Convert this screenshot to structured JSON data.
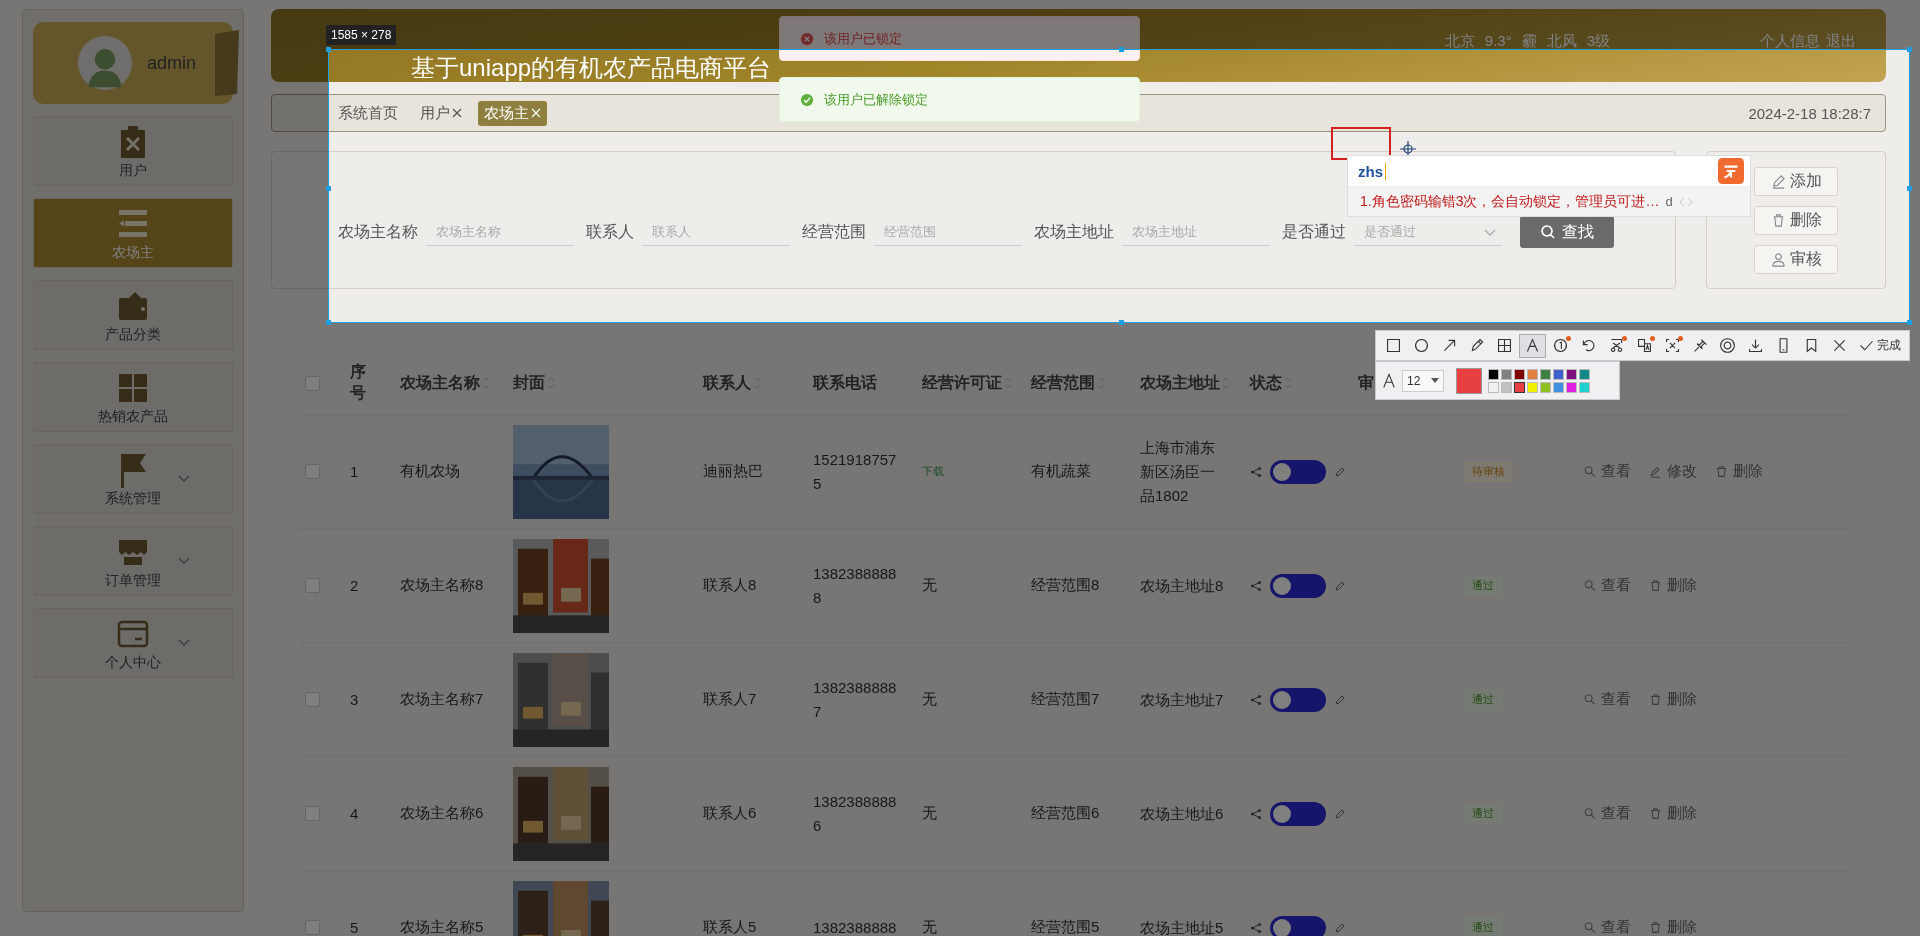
{
  "sidebar": {
    "user": "admin",
    "menu": [
      {
        "label": "用户",
        "selected": false,
        "expandable": false
      },
      {
        "label": "农场主",
        "selected": true,
        "expandable": false
      },
      {
        "label": "产品分类",
        "selected": false,
        "expandable": false
      },
      {
        "label": "热销农产品",
        "selected": false,
        "expandable": false
      },
      {
        "label": "系统管理",
        "selected": false,
        "expandable": true
      },
      {
        "label": "订单管理",
        "selected": false,
        "expandable": true
      },
      {
        "label": "个人中心",
        "selected": false,
        "expandable": true
      }
    ]
  },
  "header": {
    "title": "基于uniapp的有机农产品电商平台",
    "weather": [
      "北京",
      "9.3°",
      "霾",
      "北风",
      "3级"
    ],
    "links": [
      "个人信息",
      "退出"
    ]
  },
  "breadcrumb": {
    "tabs": [
      {
        "label": "系统首页",
        "closable": false,
        "selected": false
      },
      {
        "label": "用户",
        "closable": true,
        "selected": false
      },
      {
        "label": "农场主",
        "closable": true,
        "selected": true
      }
    ],
    "datetime": "2024-2-18 18:28:7"
  },
  "search": {
    "fields": [
      {
        "label": "农场主名称",
        "placeholder": "农场主名称",
        "kind": "input"
      },
      {
        "label": "联系人",
        "placeholder": "联系人",
        "kind": "input"
      },
      {
        "label": "经营范围",
        "placeholder": "经营范围",
        "kind": "input"
      },
      {
        "label": "农场主地址",
        "placeholder": "农场主地址",
        "kind": "input"
      },
      {
        "label": "是否通过",
        "placeholder": "是否通过",
        "kind": "select"
      }
    ],
    "button": "查找"
  },
  "side_buttons": [
    "添加",
    "删除",
    "审核"
  ],
  "table": {
    "all_checked": false,
    "columns": [
      {
        "label": "序号",
        "sortable": false
      },
      {
        "label": "农场主名称",
        "sortable": true
      },
      {
        "label": "封面",
        "sortable": true
      },
      {
        "label": "联系人",
        "sortable": true
      },
      {
        "label": "联系电话",
        "sortable": false
      },
      {
        "label": "经营许可证",
        "sortable": true
      },
      {
        "label": "经营范围",
        "sortable": true
      },
      {
        "label": "农场主地址",
        "sortable": true
      },
      {
        "label": "状态",
        "sortable": true
      },
      {
        "label": "审",
        "sortable": false
      }
    ],
    "rows": [
      {
        "checked": false,
        "index": "1",
        "name": "有机农场",
        "cover": {
          "kind": "picture"
        },
        "contact": "迪丽热巴",
        "phone": "15219187575",
        "license": {
          "kind": "link",
          "text": "下载"
        },
        "scope": "有机蔬菜",
        "address": "上海市浦东新区汤臣一品1802",
        "on": false,
        "review": {
          "kind": "pending",
          "text": "待审核"
        },
        "actions": [
          {
            "kind": "view",
            "label": "查看"
          },
          {
            "kind": "edit",
            "label": "修改"
          },
          {
            "kind": "delete",
            "label": "删除"
          }
        ]
      },
      {
        "checked": false,
        "index": "2",
        "name": "农场主名称8",
        "cover": {
          "kind": "picture"
        },
        "contact": "联系人8",
        "phone": "13823888888",
        "license": {
          "kind": "text",
          "text": "无"
        },
        "scope": "经营范围8",
        "address": "农场主地址8",
        "on": false,
        "review": {
          "kind": "passed",
          "text": "通过"
        },
        "actions": [
          {
            "kind": "view",
            "label": "查看"
          },
          {
            "kind": "delete",
            "label": "删除"
          }
        ]
      },
      {
        "checked": false,
        "index": "3",
        "name": "农场主名称7",
        "cover": {
          "kind": "picture"
        },
        "contact": "联系人7",
        "phone": "13823888887",
        "license": {
          "kind": "text",
          "text": "无"
        },
        "scope": "经营范围7",
        "address": "农场主地址7",
        "on": false,
        "review": {
          "kind": "passed",
          "text": "通过"
        },
        "actions": [
          {
            "kind": "view",
            "label": "查看"
          },
          {
            "kind": "delete",
            "label": "删除"
          }
        ]
      },
      {
        "checked": false,
        "index": "4",
        "name": "农场主名称6",
        "cover": {
          "kind": "picture"
        },
        "contact": "联系人6",
        "phone": "13823888886",
        "license": {
          "kind": "text",
          "text": "无"
        },
        "scope": "经营范围6",
        "address": "农场主地址6",
        "on": false,
        "review": {
          "kind": "passed",
          "text": "通过"
        },
        "actions": [
          {
            "kind": "view",
            "label": "查看"
          },
          {
            "kind": "delete",
            "label": "删除"
          }
        ]
      },
      {
        "checked": false,
        "index": "5",
        "name": "农场主名称5",
        "cover": {
          "kind": "picture"
        },
        "contact": "联系人5",
        "phone": "1382388888",
        "license": {
          "kind": "text",
          "text": "无"
        },
        "scope": "经营范围5",
        "address": "农场主地址5",
        "on": false,
        "review": {
          "kind": "passed",
          "text": "通过"
        },
        "actions": [
          {
            "kind": "view",
            "label": "查看"
          },
          {
            "kind": "delete",
            "label": "删除"
          }
        ]
      }
    ]
  },
  "toasts": [
    {
      "kind": "error",
      "text": "该用户已锁定"
    },
    {
      "kind": "success",
      "text": "该用户已解除锁定"
    }
  ],
  "capture": {
    "size_label": "1585 × 278",
    "ime": {
      "input": "zhs",
      "candidate": "1.角色密码输错3次，会自动锁定，管理员可进…",
      "extra": "d"
    },
    "tools": [
      {
        "kind": "rect",
        "selected": false,
        "badge": false
      },
      {
        "kind": "circle",
        "selected": false,
        "badge": false
      },
      {
        "kind": "arrow",
        "selected": false,
        "badge": false
      },
      {
        "kind": "pencil",
        "selected": false,
        "badge": false
      },
      {
        "kind": "mosaic",
        "selected": false,
        "badge": false
      },
      {
        "kind": "text",
        "selected": true,
        "badge": false
      },
      {
        "kind": "number",
        "selected": false,
        "badge": true
      },
      {
        "kind": "undo",
        "selected": false,
        "badge": false
      },
      {
        "kind": "scissors",
        "selected": false,
        "badge": true
      },
      {
        "kind": "translate",
        "selected": false,
        "badge": true
      },
      {
        "kind": "ocr",
        "selected": false,
        "badge": true
      },
      {
        "kind": "pin",
        "selected": false,
        "badge": false
      },
      {
        "kind": "record",
        "selected": false,
        "badge": false
      },
      {
        "kind": "download",
        "selected": false,
        "badge": false
      },
      {
        "kind": "phone",
        "selected": false,
        "badge": false
      },
      {
        "kind": "bookmark",
        "selected": false,
        "badge": false
      },
      {
        "kind": "close",
        "selected": false,
        "badge": false
      }
    ],
    "done": "完成",
    "font_size": "12",
    "swatches": [
      {
        "color": "#000000",
        "selected": false
      },
      {
        "color": "#808080",
        "selected": false
      },
      {
        "color": "#800000",
        "selected": false
      },
      {
        "color": "#e08040",
        "selected": false
      },
      {
        "color": "#408040",
        "selected": false
      },
      {
        "color": "#4060d0",
        "selected": false
      },
      {
        "color": "#801080",
        "selected": false
      },
      {
        "color": "#108888",
        "selected": false
      },
      {
        "color": "#f0f0f0",
        "selected": false
      },
      {
        "color": "#c0c0c0",
        "selected": false
      },
      {
        "color": "#e84040",
        "selected": true
      },
      {
        "color": "#f0f000",
        "selected": false
      },
      {
        "color": "#90c020",
        "selected": false
      },
      {
        "color": "#4090e0",
        "selected": false
      },
      {
        "color": "#e020e0",
        "selected": false
      },
      {
        "color": "#20d0d0",
        "selected": false
      }
    ]
  }
}
